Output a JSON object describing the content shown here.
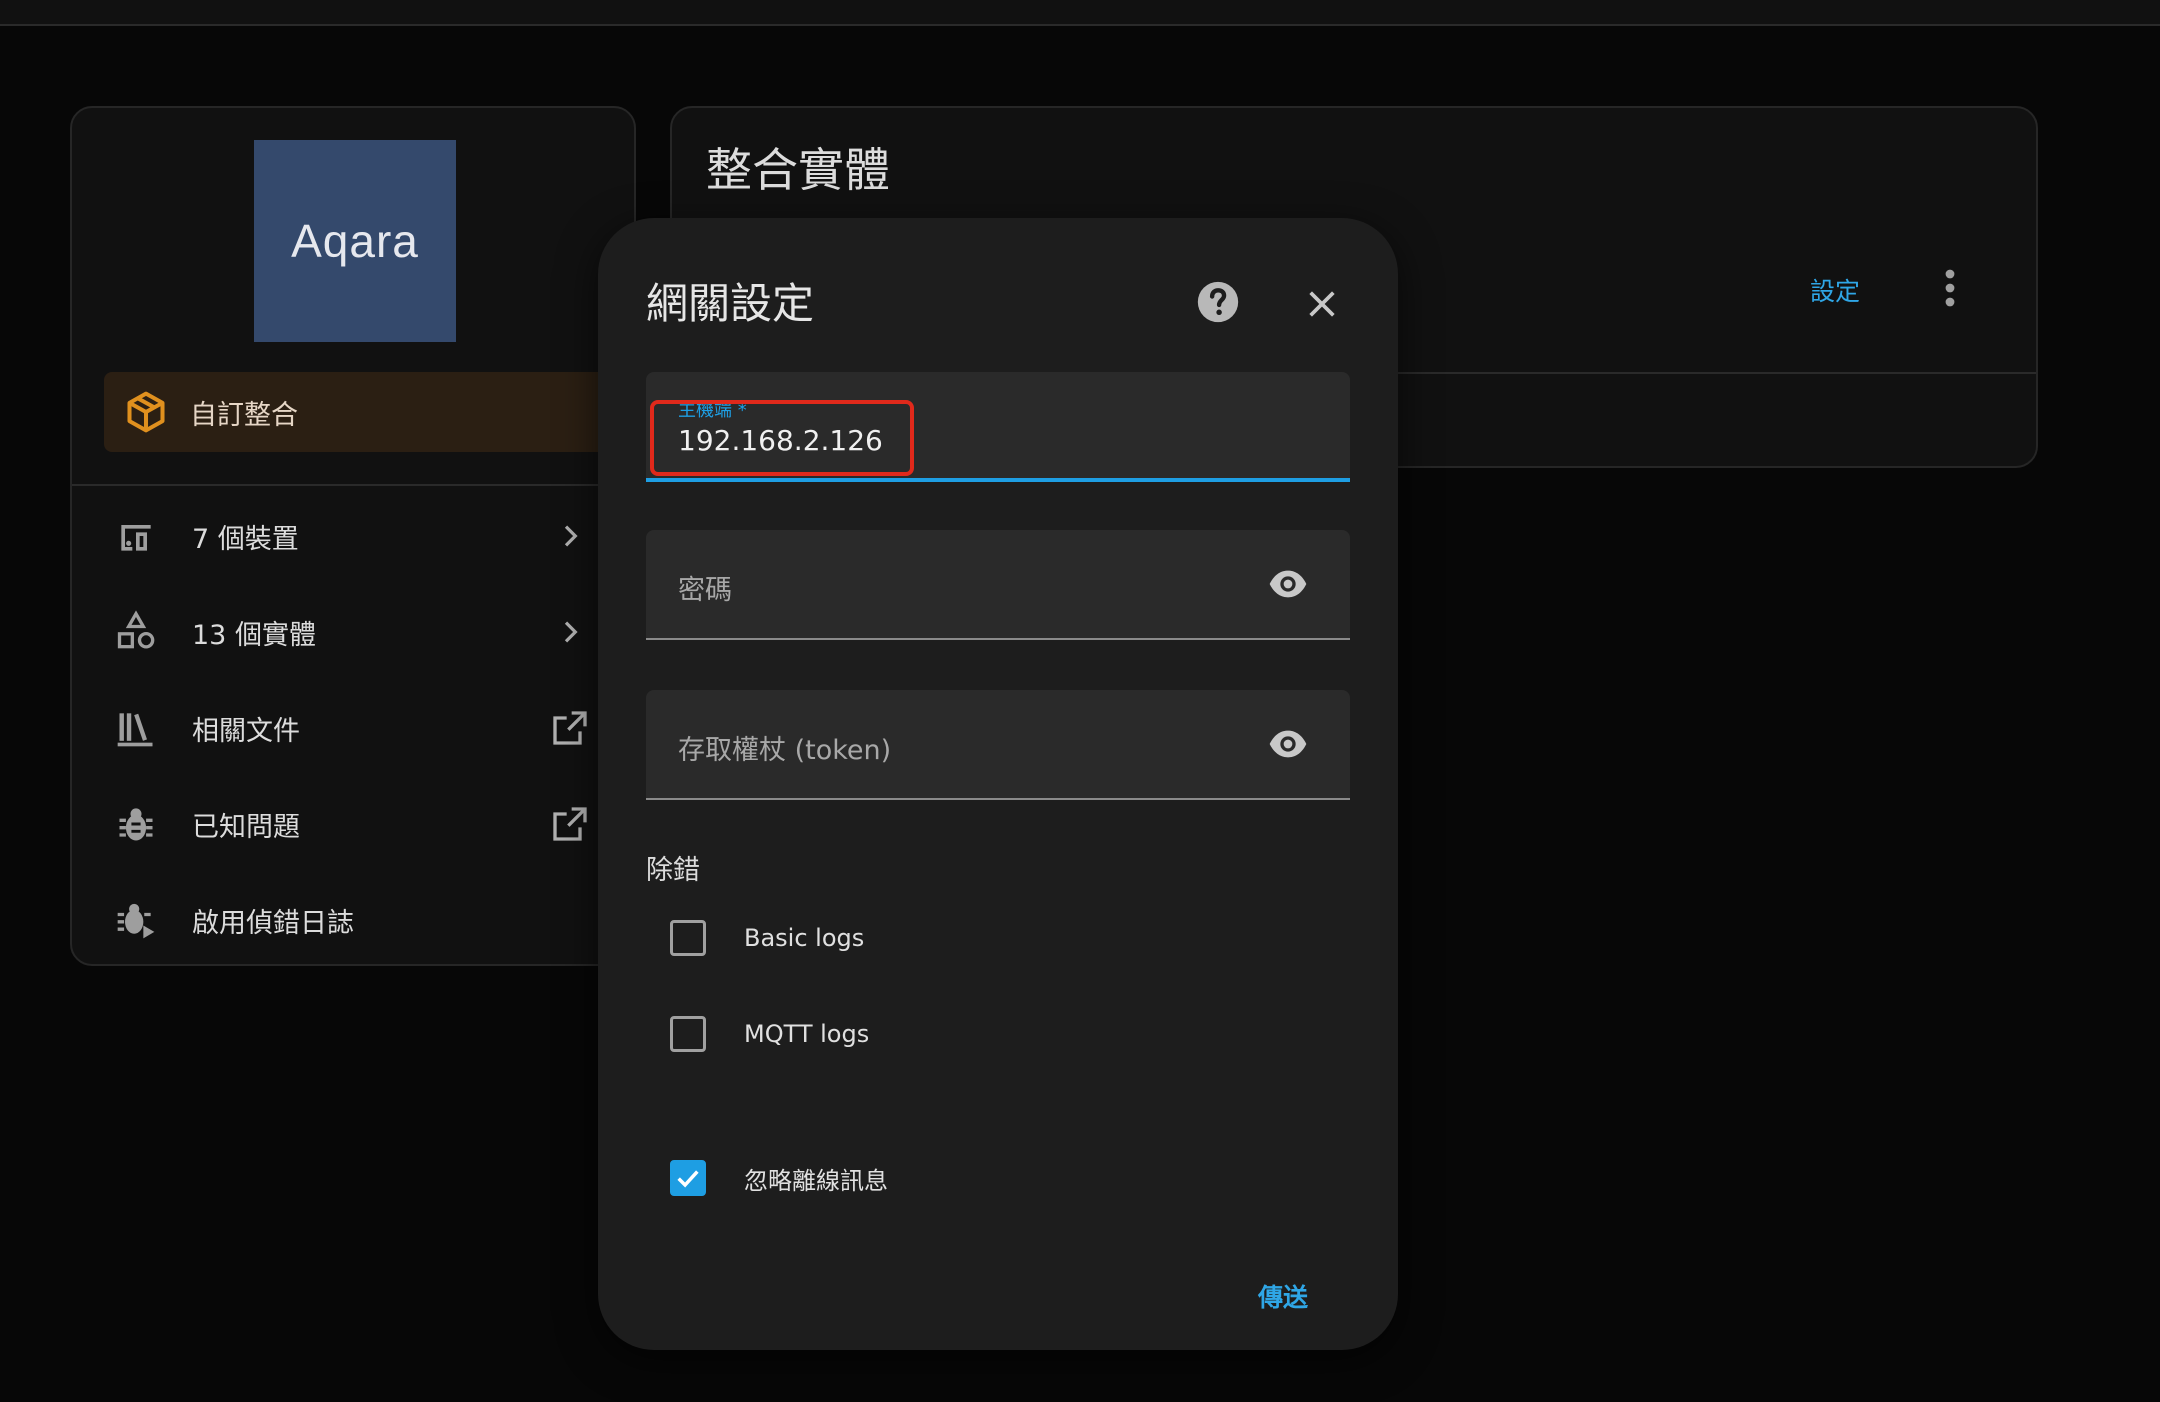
{
  "left_card": {
    "logo_text": "Aqara",
    "custom_integration_label": "自訂整合",
    "menu": [
      {
        "label": "7 個裝置",
        "icon": "devices-icon",
        "trail": "chevron-right-icon"
      },
      {
        "label": "13 個實體",
        "icon": "shapes-icon",
        "trail": "chevron-right-icon"
      },
      {
        "label": "相關文件",
        "icon": "library-books-icon",
        "trail": "open-in-new-icon"
      },
      {
        "label": "已知問題",
        "icon": "bug-icon",
        "trail": "open-in-new-icon"
      },
      {
        "label": "啟用偵錯日誌",
        "icon": "bug-play-icon",
        "trail": ""
      }
    ]
  },
  "right_card": {
    "title": "整合實體",
    "settings_label": "設定"
  },
  "dialog": {
    "title": "網關設定",
    "host": {
      "label": "主機端 *",
      "value": "192.168.2.126"
    },
    "password": {
      "label": "密碼"
    },
    "token": {
      "label": "存取權杖 (token)"
    },
    "debug_section_label": "除錯",
    "options": [
      {
        "label": "Basic logs",
        "checked": false
      },
      {
        "label": "MQTT logs",
        "checked": false
      },
      {
        "label": "忽略離線訊息",
        "checked": true
      }
    ],
    "submit_label": "傳送"
  },
  "colors": {
    "accent": "#1e9ee3",
    "highlight": "#e0291b",
    "custom_icon": "#e0901e",
    "logo_bg": "#34496c"
  }
}
